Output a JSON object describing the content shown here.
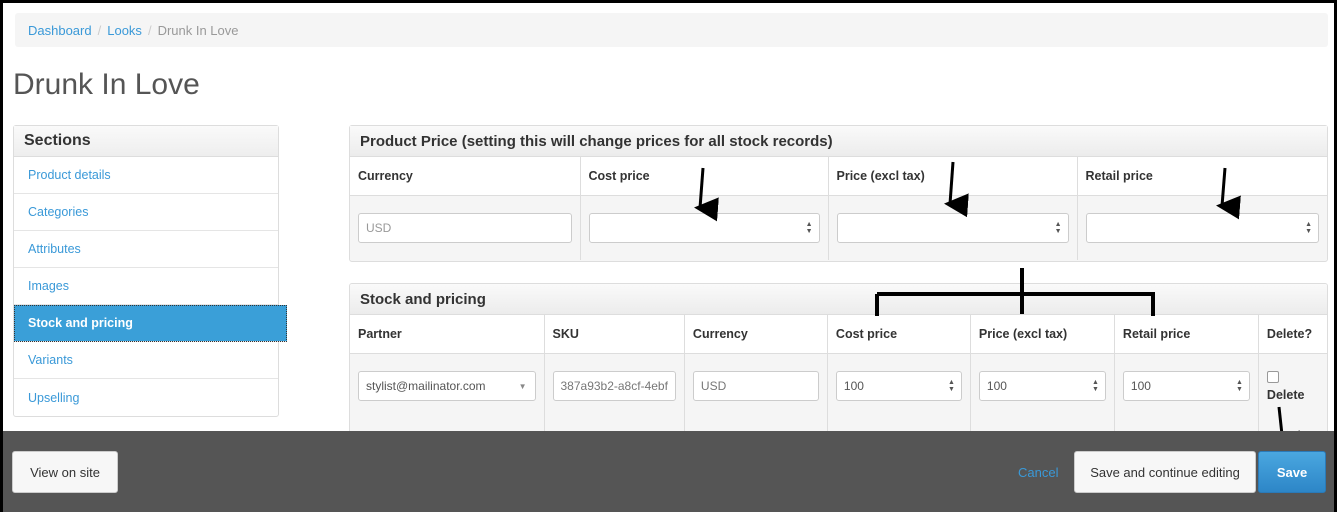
{
  "breadcrumb": {
    "item1": "Dashboard",
    "sep": "/",
    "item2": "Looks",
    "current": "Drunk In Love"
  },
  "page": {
    "title": "Drunk In Love"
  },
  "sidebar": {
    "header": "Sections",
    "items": [
      {
        "label": "Product details"
      },
      {
        "label": "Categories"
      },
      {
        "label": "Attributes"
      },
      {
        "label": "Images"
      },
      {
        "label": "Stock and pricing"
      },
      {
        "label": "Variants"
      },
      {
        "label": "Upselling"
      }
    ]
  },
  "product_price": {
    "title": "Product Price (setting this will change prices for all stock records)",
    "headers": [
      "Currency",
      "Cost price",
      "Price (excl tax)",
      "Retail price"
    ],
    "currency_placeholder": "USD"
  },
  "stock": {
    "title": "Stock and pricing",
    "headers": [
      "Partner",
      "SKU",
      "Currency",
      "Cost price",
      "Price (excl tax)",
      "Retail price",
      "Delete?"
    ],
    "row": {
      "partner": "stylist@mailinator.com",
      "sku": "387a93b2-a8cf-4ebf",
      "currency": "USD",
      "cost": "100",
      "price_excl": "100",
      "retail": "100",
      "delete_label": "Delete"
    }
  },
  "footer": {
    "view_on_site": "View on site",
    "cancel": "Cancel",
    "save_continue": "Save and continue editing",
    "save": "Save"
  },
  "icons": {
    "spinner": "spinner-arrows-icon",
    "select": "caret-down-icon"
  }
}
